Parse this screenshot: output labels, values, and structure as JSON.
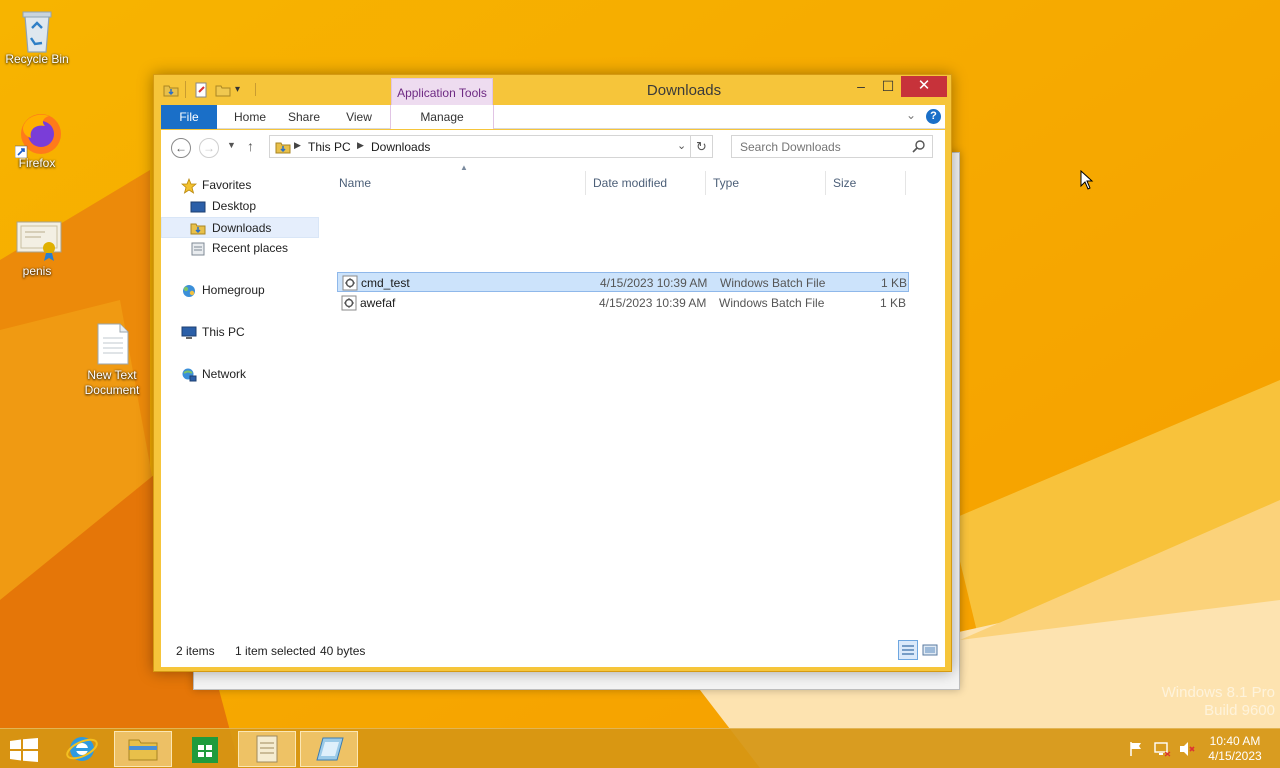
{
  "desktop": {
    "icons": [
      {
        "label": "Recycle Bin"
      },
      {
        "label": "Firefox"
      },
      {
        "label": "penis"
      },
      {
        "label": "New Text Document"
      }
    ],
    "watermark": {
      "line1": "Windows 8.1 Pro",
      "line2": "Build 9600"
    }
  },
  "window": {
    "title": "Downloads",
    "contextual_tab_group": "Application Tools",
    "buttons": {
      "minimize": "–",
      "maximize": "☐",
      "close": "✕"
    },
    "ribbon_tabs": [
      "File",
      "Home",
      "Share",
      "View",
      "Manage"
    ],
    "address": {
      "crumbs": [
        "This PC",
        "Downloads"
      ]
    },
    "search": {
      "placeholder": "Search Downloads"
    },
    "nav_pane": {
      "favorites": "Favorites",
      "favorites_items": [
        "Desktop",
        "Downloads",
        "Recent places"
      ],
      "homegroup": "Homegroup",
      "this_pc": "This PC",
      "network": "Network"
    },
    "columns": [
      "Name",
      "Date modified",
      "Type",
      "Size"
    ],
    "files": [
      {
        "name": "cmd_test",
        "date": "4/15/2023 10:39 AM",
        "type": "Windows Batch File",
        "size": "1 KB",
        "selected": true
      },
      {
        "name": "awefaf",
        "date": "4/15/2023 10:39 AM",
        "type": "Windows Batch File",
        "size": "1 KB",
        "selected": false
      }
    ],
    "status": {
      "count": "2 items",
      "selection": "1 item selected",
      "bytes": "40 bytes"
    }
  },
  "taskbar": {
    "time": "10:40 AM",
    "date": "4/15/2023"
  },
  "colors": {
    "accent": "#1a6fc8",
    "wallpaper": "#f6a800",
    "close": "#c7323a",
    "selection": "#cce3fb"
  }
}
